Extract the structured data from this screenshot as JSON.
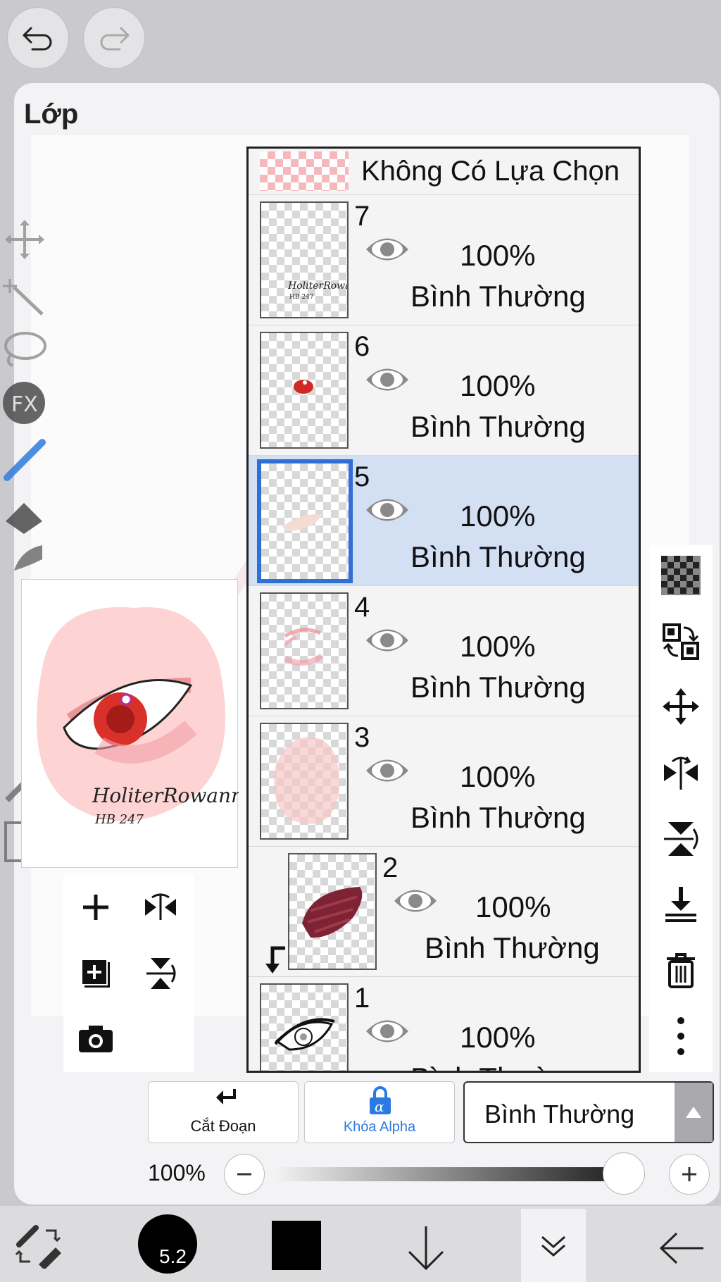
{
  "panel": {
    "title": "Lớp"
  },
  "selection_row": {
    "label": "Không Có Lựa Chọn"
  },
  "layers": [
    {
      "number": "7",
      "opacity": "100%",
      "blend": "Bình Thường",
      "visible": true,
      "selected": false,
      "clipped": false,
      "thumb": "signature"
    },
    {
      "number": "6",
      "opacity": "100%",
      "blend": "Bình Thường",
      "visible": true,
      "selected": false,
      "clipped": false,
      "thumb": "red-dot"
    },
    {
      "number": "5",
      "opacity": "100%",
      "blend": "Bình Thường",
      "visible": true,
      "selected": true,
      "clipped": false,
      "thumb": "highlight"
    },
    {
      "number": "4",
      "opacity": "100%",
      "blend": "Bình Thường",
      "visible": true,
      "selected": false,
      "clipped": false,
      "thumb": "lines"
    },
    {
      "number": "3",
      "opacity": "100%",
      "blend": "Bình Thường",
      "visible": true,
      "selected": false,
      "clipped": false,
      "thumb": "pink-blob"
    },
    {
      "number": "2",
      "opacity": "100%",
      "blend": "Bình Thường",
      "visible": true,
      "selected": false,
      "clipped": true,
      "thumb": "dark-scribble"
    },
    {
      "number": "1",
      "opacity": "100%",
      "blend": "Bình Thường",
      "visible": true,
      "selected": false,
      "clipped": false,
      "thumb": "eye-lineart"
    }
  ],
  "preview": {
    "signature": "HoliterRowann",
    "sub": "HB 247"
  },
  "bottom_controls": {
    "clip_label": "Cắt Đoạn",
    "alpha_lock_label": "Khóa Alpha",
    "blend_mode": "Bình Thường",
    "opacity_label": "100%",
    "opacity_value": 1.0
  },
  "toolbar": {
    "brush_size": "5.2",
    "color": "#000000"
  },
  "colors": {
    "accent": "#2f6fd6",
    "selected_row": "#d3e0f4",
    "alpha_blue": "#2a7ae2"
  }
}
